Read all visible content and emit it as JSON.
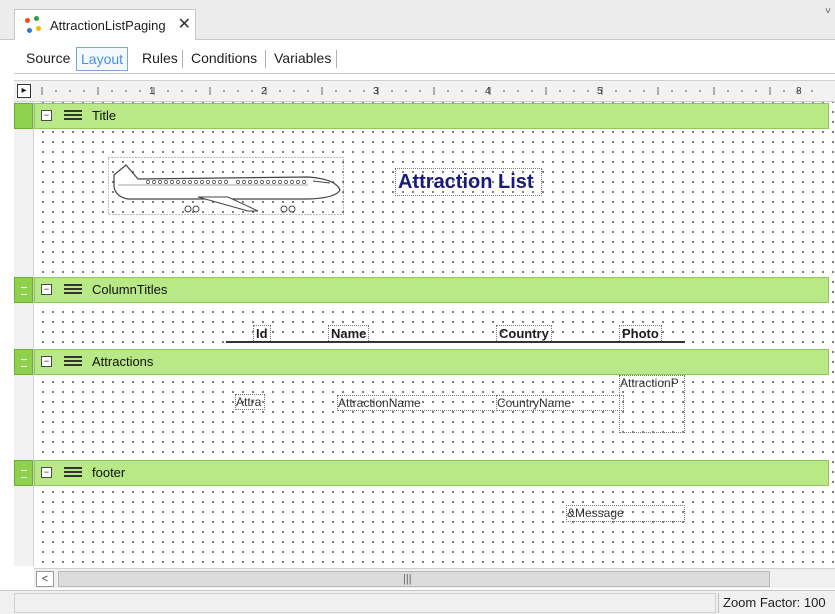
{
  "document_tab": {
    "title": "AttractionListPaging",
    "close_glyph": "✕"
  },
  "editor_tabs": [
    {
      "label": "Source",
      "active": false
    },
    {
      "label": "Layout",
      "active": true
    },
    {
      "label": "Rules",
      "active": false
    },
    {
      "label": "Conditions",
      "active": false
    },
    {
      "label": "Variables",
      "active": false
    }
  ],
  "ruler": {
    "numbers": [
      "1",
      "2",
      "3",
      "4",
      "5",
      "8"
    ]
  },
  "bands": {
    "title": {
      "name": "Title",
      "heading": "Attraction List"
    },
    "column_titles": {
      "name": "ColumnTitles",
      "columns": [
        "Id",
        "Name",
        "Country",
        "Photo"
      ]
    },
    "attractions": {
      "name": "Attractions",
      "fields": {
        "id": "Attra",
        "name": "AttractionName",
        "country": "CountryName",
        "photo": "AttractionP"
      }
    },
    "footer": {
      "name": "footer",
      "fields": {
        "message": "&Message"
      }
    }
  },
  "status": {
    "zoom": "Zoom Factor: 100"
  },
  "colors": {
    "band_bar": "#b8e986",
    "band_handle": "#8fd14f",
    "title_text": "#1a1a7a",
    "active_tab": "#4a8fd8"
  },
  "icons": {
    "object": "genexus-object-icon",
    "band": "band-lines-icon",
    "collapse": "collapse-minus-icon",
    "ruler_toggle": "ruler-toggle-icon",
    "airplane": "airplane-image"
  }
}
